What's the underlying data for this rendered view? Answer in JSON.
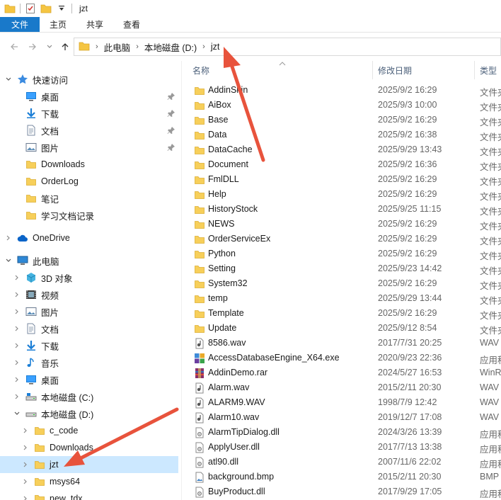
{
  "window": {
    "title": "jzt"
  },
  "ribbon": {
    "tabs": [
      "文件",
      "主页",
      "共享",
      "查看"
    ]
  },
  "address": {
    "crumbs": [
      "此电脑",
      "本地磁盘 (D:)",
      "jzt"
    ]
  },
  "columns": {
    "name": "名称",
    "date": "修改日期",
    "type": "类型"
  },
  "nav": {
    "quick_access": "快速访问",
    "quick_items": [
      {
        "label": "桌面",
        "icon": "desktop-icon",
        "pinned": true
      },
      {
        "label": "下载",
        "icon": "download-icon",
        "pinned": true
      },
      {
        "label": "文档",
        "icon": "document-icon",
        "pinned": true
      },
      {
        "label": "图片",
        "icon": "picture-icon",
        "pinned": true
      },
      {
        "label": "Downloads",
        "icon": "folder-icon",
        "pinned": false
      },
      {
        "label": "OrderLog",
        "icon": "folder-icon",
        "pinned": false
      },
      {
        "label": "笔记",
        "icon": "folder-icon",
        "pinned": false
      },
      {
        "label": "学习文档记录",
        "icon": "folder-icon",
        "pinned": false
      }
    ],
    "onedrive": "OneDrive",
    "this_pc": "此电脑",
    "pc_items": [
      {
        "label": "3D 对象",
        "icon": "cube-icon"
      },
      {
        "label": "视频",
        "icon": "video-icon"
      },
      {
        "label": "图片",
        "icon": "picture-icon"
      },
      {
        "label": "文档",
        "icon": "document-icon"
      },
      {
        "label": "下载",
        "icon": "download-icon"
      },
      {
        "label": "音乐",
        "icon": "music-icon"
      },
      {
        "label": "桌面",
        "icon": "desktop-icon"
      },
      {
        "label": "本地磁盘 (C:)",
        "icon": "drive-c-icon"
      },
      {
        "label": "本地磁盘 (D:)",
        "icon": "drive-d-icon"
      }
    ],
    "d_items": [
      {
        "label": "c_code",
        "selected": false
      },
      {
        "label": "Downloads",
        "selected": false
      },
      {
        "label": "jzt",
        "selected": true
      },
      {
        "label": "msys64",
        "selected": false
      },
      {
        "label": "new_tdx",
        "selected": false
      }
    ]
  },
  "files": [
    {
      "name": "AddinSkin",
      "date": "2025/9/2 16:29",
      "type": "文件夹",
      "kind": "folder"
    },
    {
      "name": "AiBox",
      "date": "2025/9/3 10:00",
      "type": "文件夹",
      "kind": "folder"
    },
    {
      "name": "Base",
      "date": "2025/9/2 16:29",
      "type": "文件夹",
      "kind": "folder"
    },
    {
      "name": "Data",
      "date": "2025/9/2 16:38",
      "type": "文件夹",
      "kind": "folder"
    },
    {
      "name": "DataCache",
      "date": "2025/9/29 13:43",
      "type": "文件夹",
      "kind": "folder"
    },
    {
      "name": "Document",
      "date": "2025/9/2 16:36",
      "type": "文件夹",
      "kind": "folder"
    },
    {
      "name": "FmlDLL",
      "date": "2025/9/2 16:29",
      "type": "文件夹",
      "kind": "folder"
    },
    {
      "name": "Help",
      "date": "2025/9/2 16:29",
      "type": "文件夹",
      "kind": "folder"
    },
    {
      "name": "HistoryStock",
      "date": "2025/9/25 11:15",
      "type": "文件夹",
      "kind": "folder"
    },
    {
      "name": "NEWS",
      "date": "2025/9/2 16:29",
      "type": "文件夹",
      "kind": "folder"
    },
    {
      "name": "OrderServiceEx",
      "date": "2025/9/2 16:29",
      "type": "文件夹",
      "kind": "folder"
    },
    {
      "name": "Python",
      "date": "2025/9/2 16:29",
      "type": "文件夹",
      "kind": "folder"
    },
    {
      "name": "Setting",
      "date": "2025/9/23 14:42",
      "type": "文件夹",
      "kind": "folder"
    },
    {
      "name": "System32",
      "date": "2025/9/2 16:29",
      "type": "文件夹",
      "kind": "folder"
    },
    {
      "name": "temp",
      "date": "2025/9/29 13:44",
      "type": "文件夹",
      "kind": "folder"
    },
    {
      "name": "Template",
      "date": "2025/9/2 16:29",
      "type": "文件夹",
      "kind": "folder"
    },
    {
      "name": "Update",
      "date": "2025/9/12 8:54",
      "type": "文件夹",
      "kind": "folder"
    },
    {
      "name": "8586.wav",
      "date": "2017/7/31 20:25",
      "type": "WAV",
      "kind": "wav"
    },
    {
      "name": "AccessDatabaseEngine_X64.exe",
      "date": "2020/9/23 22:36",
      "type": "应用程",
      "kind": "exe"
    },
    {
      "name": "AddinDemo.rar",
      "date": "2024/5/27 16:53",
      "type": "WinRAR",
      "kind": "rar"
    },
    {
      "name": "Alarm.wav",
      "date": "2015/2/11 20:30",
      "type": "WAV",
      "kind": "wav"
    },
    {
      "name": "ALARM9.WAV",
      "date": "1998/7/9 12:42",
      "type": "WAV",
      "kind": "wav"
    },
    {
      "name": "Alarm10.wav",
      "date": "2019/12/7 17:08",
      "type": "WAV",
      "kind": "wav"
    },
    {
      "name": "AlarmTipDialog.dll",
      "date": "2024/3/26 13:39",
      "type": "应用程",
      "kind": "dll"
    },
    {
      "name": "ApplyUser.dll",
      "date": "2017/7/13 13:38",
      "type": "应用程",
      "kind": "dll"
    },
    {
      "name": "atl90.dll",
      "date": "2007/11/6 22:02",
      "type": "应用程",
      "kind": "dll"
    },
    {
      "name": "background.bmp",
      "date": "2015/2/11 20:30",
      "type": "BMP",
      "kind": "bmp"
    },
    {
      "name": "BuyProduct.dll",
      "date": "2017/9/29 17:05",
      "type": "应用程",
      "kind": "dll"
    }
  ],
  "colors": {
    "accent": "#1979ca",
    "selected": "#cce8ff",
    "folder": "#f5c542",
    "arrow": "#e8533c"
  }
}
